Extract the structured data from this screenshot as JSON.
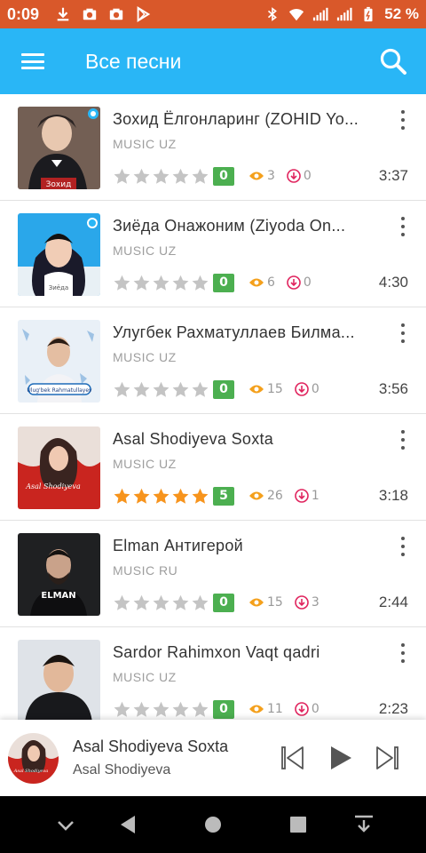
{
  "status_bar": {
    "time": "0:09",
    "battery_text": "52 %",
    "color": "#d9582a"
  },
  "app_bar": {
    "title": "Все песни",
    "color": "#29b6f6"
  },
  "songs": [
    {
      "title": "Зохид Ёлгонларинг (ZOHID Yo...",
      "subtitle": "MUSIC UZ",
      "rating": 0,
      "badge": "0",
      "views": "3",
      "downloads": "0",
      "duration": "3:37",
      "thumb_caption": "Зохид"
    },
    {
      "title": "Зиёда Онажоним (Ziyoda On...",
      "subtitle": "MUSIC UZ",
      "rating": 0,
      "badge": "0",
      "views": "6",
      "downloads": "0",
      "duration": "4:30",
      "thumb_caption": "Зиёда"
    },
    {
      "title": "Улугбек Рахматуллаев Билма...",
      "subtitle": "MUSIC UZ",
      "rating": 0,
      "badge": "0",
      "views": "15",
      "downloads": "0",
      "duration": "3:56",
      "thumb_caption": "Ulug'bek Rahmatullayev"
    },
    {
      "title": "Asal Shodiyeva Soxta",
      "subtitle": "MUSIC UZ",
      "rating": 5,
      "badge": "5",
      "views": "26",
      "downloads": "1",
      "duration": "3:18",
      "thumb_caption": "Asal Shodiyeva"
    },
    {
      "title": "Elman Антигерой",
      "subtitle": "MUSIC RU",
      "rating": 0,
      "badge": "0",
      "views": "15",
      "downloads": "3",
      "duration": "2:44",
      "thumb_caption": "ELMAN"
    },
    {
      "title": "Sardor Rahimxon Vaqt qadri",
      "subtitle": "MUSIC UZ",
      "rating": 0,
      "badge": "0",
      "views": "11",
      "downloads": "0",
      "duration": "2:23",
      "thumb_caption": ""
    }
  ],
  "player": {
    "title": "Asal Shodiyeva Soxta",
    "artist": "Asal Shodiyeva",
    "art_caption": "Asal Shodiyeva"
  },
  "colors": {
    "star_on": "#f7941d",
    "star_off": "#c4c4c4",
    "badge_green": "#4caf50",
    "views_icon": "#f4a01c",
    "downloads_icon": "#e0245e"
  },
  "icons": {
    "menu": "hamburger-icon",
    "search": "search-icon",
    "more": "more-vert-icon",
    "star": "star-icon",
    "views": "eye-icon",
    "downloads": "download-icon",
    "prev": "skip-previous-icon",
    "play": "play-icon",
    "next": "skip-next-icon"
  }
}
